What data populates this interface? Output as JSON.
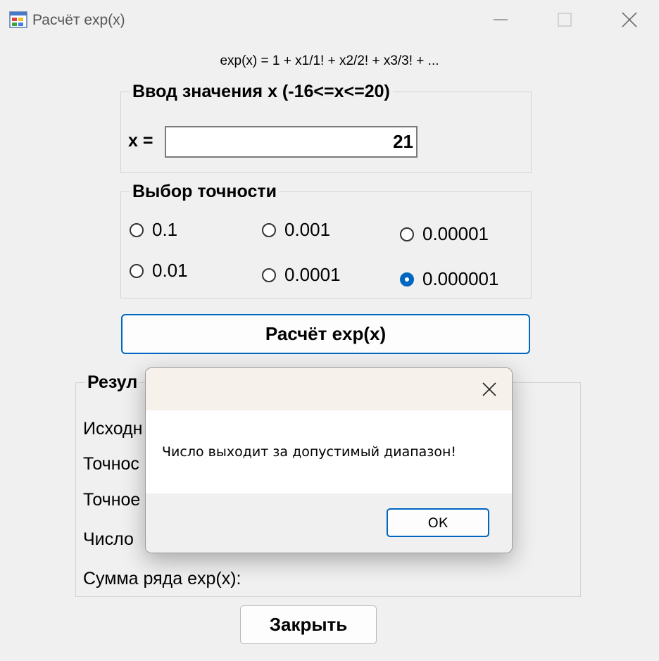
{
  "window": {
    "title": "Расчёт exp(x)",
    "icons": {
      "app": "app-form-icon",
      "minimize": "minimize-icon",
      "maximize": "maximize-icon",
      "close": "close-icon"
    }
  },
  "formula": "exp(x) = 1 + x1/1! + x2/2! + x3/3! + ...",
  "input_group": {
    "title": "Ввод значения x (-16<=x<=20)",
    "x_label": "x =",
    "x_value": "21"
  },
  "precision_group": {
    "title": "Выбор точности",
    "options": [
      "0.1",
      "0.01",
      "0.001",
      "0.0001",
      "0.00001",
      "0.000001"
    ],
    "selected": "0.000001"
  },
  "calc_button": "Расчёт exp(x)",
  "results_group": {
    "title_visible": "Резул",
    "lines": [
      "Исходн",
      "Точнос",
      "Точное",
      "Число",
      "Сумма ряда exp(x):"
    ]
  },
  "close_button": "Закрыть",
  "dialog": {
    "message": "Число выходит за допустимый диапазон!",
    "ok_label": "ОК",
    "icons": {
      "close": "dialog-close-icon"
    }
  },
  "colors": {
    "accent": "#0067c0",
    "window_bg": "#f0f0f0",
    "dialog_header": "#f7f1ec",
    "dialog_body": "#ffffff"
  }
}
